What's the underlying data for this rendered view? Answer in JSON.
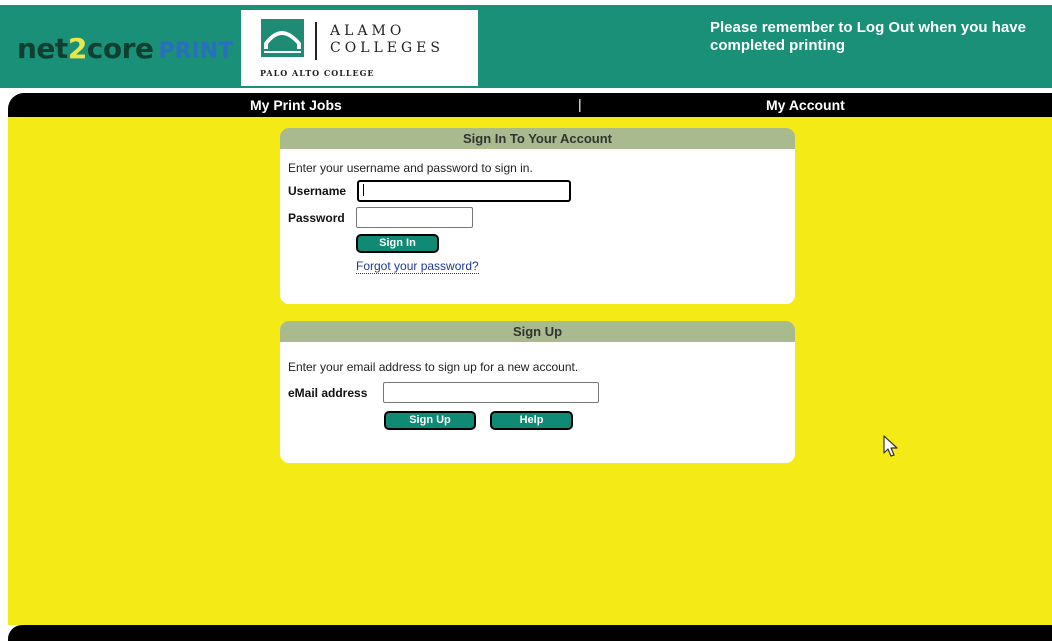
{
  "header": {
    "brand": {
      "net": "net",
      "two": "2",
      "core": "core",
      "print": "PRINT"
    },
    "college": {
      "name_line1": "ALAMO",
      "name_line2": "COLLEGES",
      "campus": "PALO ALTO COLLEGE"
    },
    "notice": "Please remember to Log Out when you have completed printing"
  },
  "nav": {
    "items": [
      {
        "label": "My Print Jobs"
      },
      {
        "label": "My Account"
      }
    ],
    "separator": "|"
  },
  "signin": {
    "title": "Sign In To Your Account",
    "instructions": "Enter your username and password to sign in.",
    "username_label": "Username",
    "username_value": "",
    "password_label": "Password",
    "password_value": "",
    "button": "Sign In",
    "forgot_link": "Forgot your password?"
  },
  "signup": {
    "title": "Sign Up",
    "instructions": "Enter your email address to sign up for a new account.",
    "email_label": "eMail address",
    "email_value": "",
    "signup_button": "Sign Up",
    "help_button": "Help"
  },
  "colors": {
    "header_bg": "#1a9078",
    "content_bg": "#f3ea16",
    "panel_header": "#a8ba8e",
    "button_bg": "#0f8a74"
  }
}
